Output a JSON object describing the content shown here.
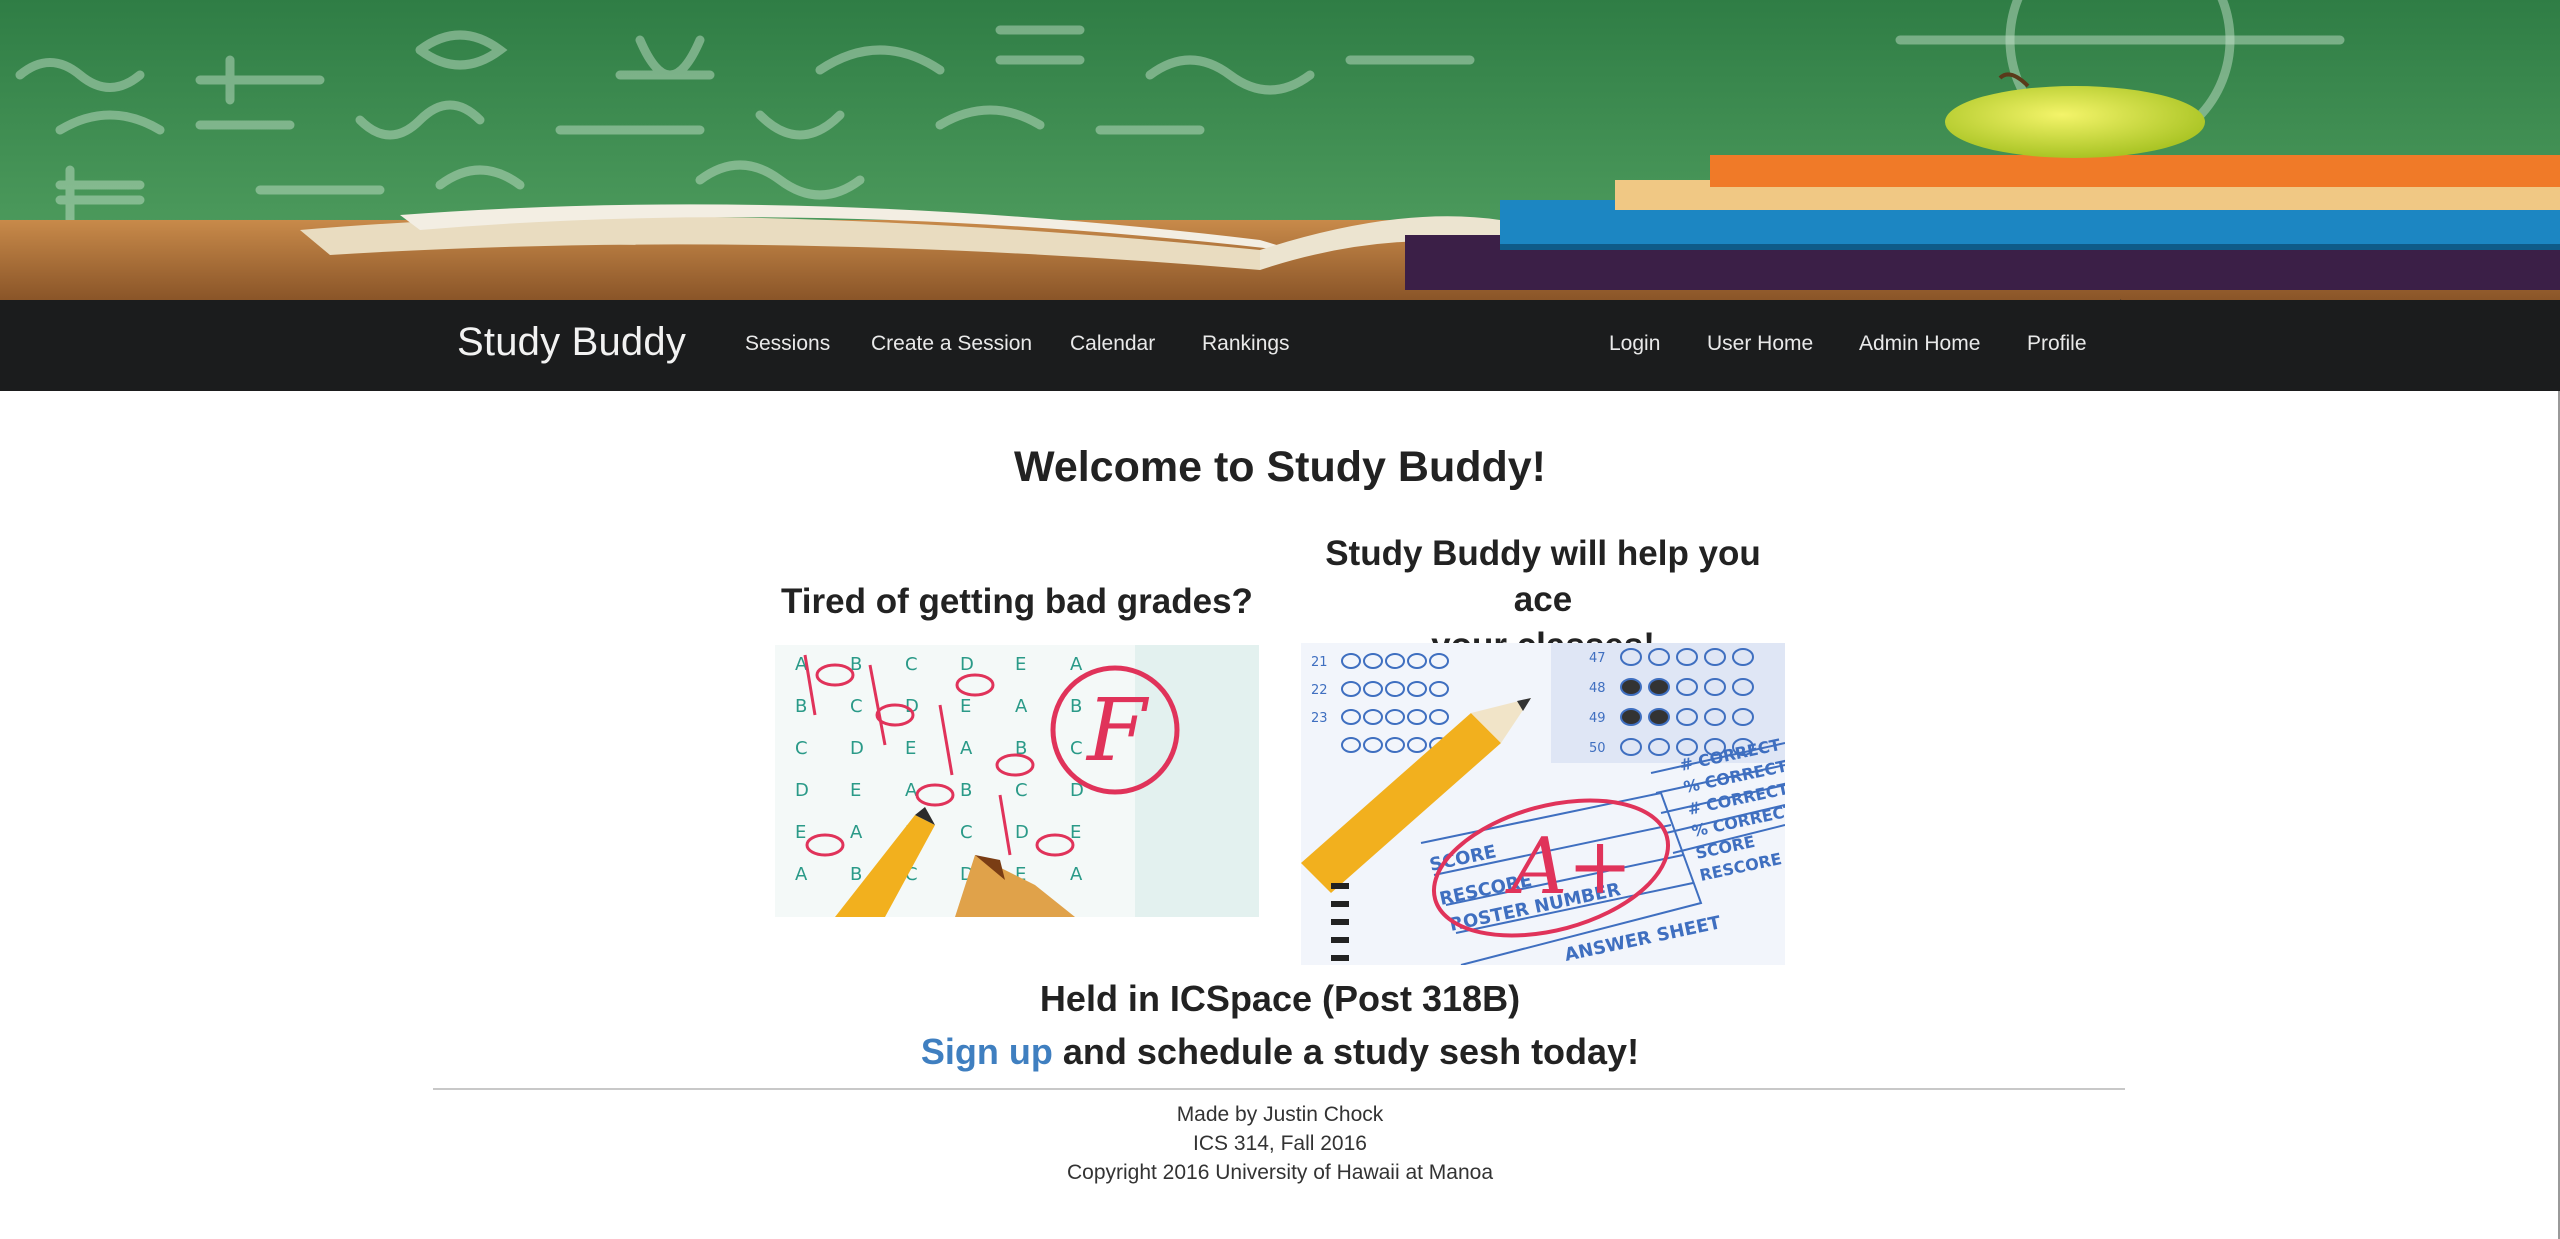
{
  "navbar": {
    "brand": "Study Buddy",
    "left_items": [
      "Sessions",
      "Create a Session",
      "Calendar",
      "Rankings"
    ],
    "right_items": [
      "Login",
      "User Home",
      "Admin Home",
      "Profile"
    ]
  },
  "main": {
    "welcome": "Welcome to Study Buddy!",
    "left_title": "Tired of getting bad grades?",
    "right_title_line1": "Study Buddy will help you ace",
    "right_title_line2": "your classes!",
    "left_image": {
      "grade": "F",
      "bubble_letters": [
        "A",
        "B",
        "C",
        "D",
        "E"
      ]
    },
    "right_image": {
      "grade": "A+",
      "score_labels": [
        "SCORE",
        "RESCORE",
        "ROSTER NUMBER",
        "ANSWER SHEET"
      ],
      "side_labels": [
        "# CORRECT",
        "% CORRECT",
        "# CORRECT",
        "% CORRECT",
        "SCORE",
        "RESCORE"
      ],
      "row_numbers": [
        "21",
        "22",
        "23",
        "47",
        "48",
        "49",
        "50"
      ]
    },
    "location": "Held in ICSpace (Post 318B)",
    "signup_link": "Sign up",
    "signup_rest": " and schedule a study sesh today!"
  },
  "footer": {
    "line1": "Made by Justin Chock",
    "line2": "ICS 314, Fall 2016",
    "line3": "Copyright 2016 University of Hawaii at Manoa"
  },
  "colors": {
    "navbar_bg": "#1b1c1d",
    "link": "#3f7fc0",
    "chalkboard": "#3f8a50",
    "grade_red": "#e0335a"
  }
}
